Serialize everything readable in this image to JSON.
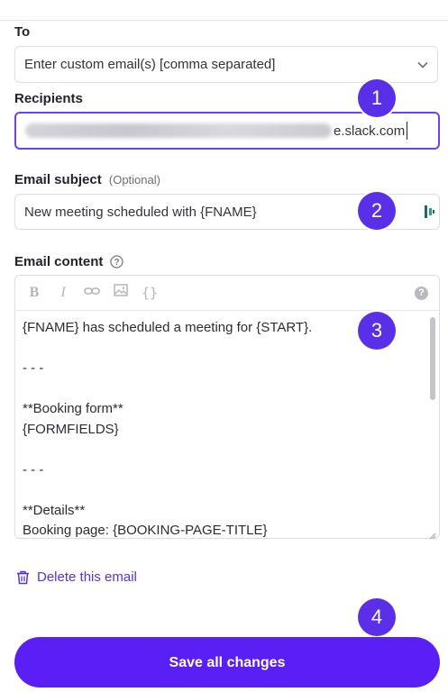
{
  "to": {
    "label": "To",
    "selected": "Enter custom email(s) [comma separated]"
  },
  "recipients": {
    "label": "Recipients",
    "value_suffix": "e.slack.com"
  },
  "subject": {
    "label": "Email subject",
    "optional": "(Optional)",
    "value": "New meeting scheduled with {FNAME}"
  },
  "content": {
    "label": "Email content",
    "toolbar": [
      "bold-icon",
      "italic-icon",
      "link-icon",
      "image-icon",
      "variable-icon",
      "help-icon"
    ],
    "lines": [
      "{FNAME} has scheduled a meeting for {START}.",
      "",
      "- - -",
      "",
      "**Booking form**",
      "{FORMFIELDS}",
      "",
      "- - -",
      "",
      "**Details**",
      "Booking page: {BOOKING-PAGE-TITLE}"
    ]
  },
  "badges": [
    "1",
    "2",
    "3",
    "4"
  ],
  "delete_label": "Delete this email",
  "save_label": "Save all changes",
  "colors": {
    "accent": "#5b2fe8",
    "button": "#5a1ff5",
    "focus_border": "#6a41f5"
  }
}
